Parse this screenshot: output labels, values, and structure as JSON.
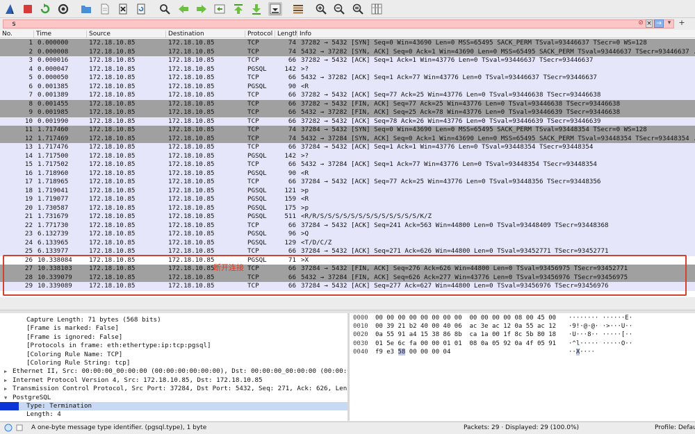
{
  "toolbar": {
    "icons": [
      "shark-fin-icon",
      "stop-capture-icon",
      "restart-capture-icon",
      "capture-options-icon",
      "open-file-icon",
      "save-file-icon",
      "close-file-icon",
      "reload-file-icon",
      "find-packet-icon",
      "go-back-icon",
      "go-forward-icon",
      "go-to-packet-icon",
      "go-first-icon",
      "go-last-icon",
      "autoscroll-icon",
      "colorize-icon",
      "zoom-in-icon",
      "zoom-out-icon",
      "zoom-normal-icon",
      "resize-columns-icon"
    ]
  },
  "filter": {
    "value": "s",
    "plus": "+"
  },
  "columns": [
    "No.",
    "Time",
    "Source",
    "Destination",
    "Protocol",
    "Length",
    "Info"
  ],
  "packets": [
    {
      "no": "1",
      "time": "0.000000",
      "src": "172.18.10.85",
      "dst": "172.18.10.85",
      "proto": "TCP",
      "len": "74",
      "info": "37282 → 5432 [SYN] Seq=0 Win=43690 Len=0 MSS=65495 SACK_PERM TSval=93446637 TSecr=0 WS=128",
      "style": "dark"
    },
    {
      "no": "2",
      "time": "0.000008",
      "src": "172.18.10.85",
      "dst": "172.18.10.85",
      "proto": "TCP",
      "len": "74",
      "info": "5432 → 37282 [SYN, ACK] Seq=0 Ack=1 Win=43690 Len=0 MSS=65495 SACK_PERM TSval=93446637 TSecr=93446637 ...",
      "style": "dark"
    },
    {
      "no": "3",
      "time": "0.000016",
      "src": "172.18.10.85",
      "dst": "172.18.10.85",
      "proto": "TCP",
      "len": "66",
      "info": "37282 → 5432 [ACK] Seq=1 Ack=1 Win=43776 Len=0 TSval=93446637 TSecr=93446637",
      "style": "light"
    },
    {
      "no": "4",
      "time": "0.000047",
      "src": "172.18.10.85",
      "dst": "172.18.10.85",
      "proto": "PGSQL",
      "len": "142",
      "info": ">?",
      "style": "light"
    },
    {
      "no": "5",
      "time": "0.000050",
      "src": "172.18.10.85",
      "dst": "172.18.10.85",
      "proto": "TCP",
      "len": "66",
      "info": "5432 → 37282 [ACK] Seq=1 Ack=77 Win=43776 Len=0 TSval=93446637 TSecr=93446637",
      "style": "light"
    },
    {
      "no": "6",
      "time": "0.001385",
      "src": "172.18.10.85",
      "dst": "172.18.10.85",
      "proto": "PGSQL",
      "len": "90",
      "info": "<R",
      "style": "light"
    },
    {
      "no": "7",
      "time": "0.001389",
      "src": "172.18.10.85",
      "dst": "172.18.10.85",
      "proto": "TCP",
      "len": "66",
      "info": "37282 → 5432 [ACK] Seq=77 Ack=25 Win=43776 Len=0 TSval=93446638 TSecr=93446638",
      "style": "light"
    },
    {
      "no": "8",
      "time": "0.001455",
      "src": "172.18.10.85",
      "dst": "172.18.10.85",
      "proto": "TCP",
      "len": "66",
      "info": "37282 → 5432 [FIN, ACK] Seq=77 Ack=25 Win=43776 Len=0 TSval=93446638 TSecr=93446638",
      "style": "dark"
    },
    {
      "no": "9",
      "time": "0.001985",
      "src": "172.18.10.85",
      "dst": "172.18.10.85",
      "proto": "TCP",
      "len": "66",
      "info": "5432 → 37282 [FIN, ACK] Seq=25 Ack=78 Win=43776 Len=0 TSval=93446639 TSecr=93446638",
      "style": "dark"
    },
    {
      "no": "10",
      "time": "0.001990",
      "src": "172.18.10.85",
      "dst": "172.18.10.85",
      "proto": "TCP",
      "len": "66",
      "info": "37282 → 5432 [ACK] Seq=78 Ack=26 Win=43776 Len=0 TSval=93446639 TSecr=93446639",
      "style": "light"
    },
    {
      "no": "11",
      "time": "1.717460",
      "src": "172.18.10.85",
      "dst": "172.18.10.85",
      "proto": "TCP",
      "len": "74",
      "info": "37284 → 5432 [SYN] Seq=0 Win=43690 Len=0 MSS=65495 SACK_PERM TSval=93448354 TSecr=0 WS=128",
      "style": "dark"
    },
    {
      "no": "12",
      "time": "1.717469",
      "src": "172.18.10.85",
      "dst": "172.18.10.85",
      "proto": "TCP",
      "len": "74",
      "info": "5432 → 37284 [SYN, ACK] Seq=0 Ack=1 Win=43690 Len=0 MSS=65495 SACK_PERM TSval=93448354 TSecr=93448354 ...",
      "style": "dark"
    },
    {
      "no": "13",
      "time": "1.717476",
      "src": "172.18.10.85",
      "dst": "172.18.10.85",
      "proto": "TCP",
      "len": "66",
      "info": "37284 → 5432 [ACK] Seq=1 Ack=1 Win=43776 Len=0 TSval=93448354 TSecr=93448354",
      "style": "light"
    },
    {
      "no": "14",
      "time": "1.717500",
      "src": "172.18.10.85",
      "dst": "172.18.10.85",
      "proto": "PGSQL",
      "len": "142",
      "info": ">?",
      "style": "light"
    },
    {
      "no": "15",
      "time": "1.717502",
      "src": "172.18.10.85",
      "dst": "172.18.10.85",
      "proto": "TCP",
      "len": "66",
      "info": "5432 → 37284 [ACK] Seq=1 Ack=77 Win=43776 Len=0 TSval=93448354 TSecr=93448354",
      "style": "light"
    },
    {
      "no": "16",
      "time": "1.718960",
      "src": "172.18.10.85",
      "dst": "172.18.10.85",
      "proto": "PGSQL",
      "len": "90",
      "info": "<R",
      "style": "light"
    },
    {
      "no": "17",
      "time": "1.718965",
      "src": "172.18.10.85",
      "dst": "172.18.10.85",
      "proto": "TCP",
      "len": "66",
      "info": "37284 → 5432 [ACK] Seq=77 Ack=25 Win=43776 Len=0 TSval=93448356 TSecr=93448356",
      "style": "light"
    },
    {
      "no": "18",
      "time": "1.719041",
      "src": "172.18.10.85",
      "dst": "172.18.10.85",
      "proto": "PGSQL",
      "len": "121",
      "info": ">p",
      "style": "light"
    },
    {
      "no": "19",
      "time": "1.719077",
      "src": "172.18.10.85",
      "dst": "172.18.10.85",
      "proto": "PGSQL",
      "len": "159",
      "info": "<R",
      "style": "light"
    },
    {
      "no": "20",
      "time": "1.730587",
      "src": "172.18.10.85",
      "dst": "172.18.10.85",
      "proto": "PGSQL",
      "len": "175",
      "info": ">p",
      "style": "light"
    },
    {
      "no": "21",
      "time": "1.731679",
      "src": "172.18.10.85",
      "dst": "172.18.10.85",
      "proto": "PGSQL",
      "len": "511",
      "info": "<R/R/S/S/S/S/S/S/S/S/S/S/S/S/S/K/Z",
      "style": "light"
    },
    {
      "no": "22",
      "time": "1.771730",
      "src": "172.18.10.85",
      "dst": "172.18.10.85",
      "proto": "TCP",
      "len": "66",
      "info": "37284 → 5432 [ACK] Seq=241 Ack=563 Win=44800 Len=0 TSval=93448409 TSecr=93448368",
      "style": "light"
    },
    {
      "no": "23",
      "time": "6.132739",
      "src": "172.18.10.85",
      "dst": "172.18.10.85",
      "proto": "PGSQL",
      "len": "96",
      "info": ">Q",
      "style": "light"
    },
    {
      "no": "24",
      "time": "6.133965",
      "src": "172.18.10.85",
      "dst": "172.18.10.85",
      "proto": "PGSQL",
      "len": "129",
      "info": "<T/D/C/Z",
      "style": "light"
    },
    {
      "no": "25",
      "time": "6.133977",
      "src": "172.18.10.85",
      "dst": "172.18.10.85",
      "proto": "TCP",
      "len": "66",
      "info": "37284 → 5432 [ACK] Seq=271 Ack=626 Win=44800 Len=0 TSval=93452771 TSecr=93452771",
      "style": "light"
    },
    {
      "no": "26",
      "time": "10.338084",
      "src": "172.18.10.85",
      "dst": "172.18.10.85",
      "proto": "PGSQL",
      "len": "71",
      "info": ">X",
      "style": "sel"
    },
    {
      "no": "27",
      "time": "10.338103",
      "src": "172.18.10.85",
      "dst": "172.18.10.85",
      "proto": "TCP",
      "len": "66",
      "info": "37284 → 5432 [FIN, ACK] Seq=276 Ack=626 Win=44800 Len=0 TSval=93456975 TSecr=93452771",
      "style": "dark"
    },
    {
      "no": "28",
      "time": "10.339079",
      "src": "172.18.10.85",
      "dst": "172.18.10.85",
      "proto": "TCP",
      "len": "66",
      "info": "5432 → 37284 [FIN, ACK] Seq=626 Ack=277 Win=43776 Len=0 TSval=93456976 TSecr=93456975",
      "style": "dark"
    },
    {
      "no": "29",
      "time": "10.339089",
      "src": "172.18.10.85",
      "dst": "172.18.10.85",
      "proto": "TCP",
      "len": "66",
      "info": "37284 → 5432 [ACK] Seq=277 Ack=627 Win=44800 Len=0 TSval=93456976 TSecr=93456976",
      "style": "light"
    }
  ],
  "annotation": {
    "text": "断开连接",
    "color": "#d4402a"
  },
  "details": [
    {
      "text": "Capture Length: 71 bytes (568 bits)",
      "indent": 2,
      "arrow": ""
    },
    {
      "text": "[Frame is marked: False]",
      "indent": 2,
      "arrow": ""
    },
    {
      "text": "[Frame is ignored: False]",
      "indent": 2,
      "arrow": ""
    },
    {
      "text": "[Protocols in frame: eth:ethertype:ip:tcp:pgsql]",
      "indent": 2,
      "arrow": ""
    },
    {
      "text": "[Coloring Rule Name: TCP]",
      "indent": 2,
      "arrow": ""
    },
    {
      "text": "[Coloring Rule String: tcp]",
      "indent": 2,
      "arrow": ""
    },
    {
      "text": "Ethernet II, Src: 00:00:00_00:00:00 (00:00:00:00:00:00), Dst: 00:00:00_00:00:00 (00:00:00:00:00:00)",
      "indent": 0,
      "arrow": ">"
    },
    {
      "text": "Internet Protocol Version 4, Src: 172.18.10.85, Dst: 172.18.10.85",
      "indent": 0,
      "arrow": ">"
    },
    {
      "text": "Transmission Control Protocol, Src Port: 37284, Dst Port: 5432, Seq: 271, Ack: 626, Len: 5",
      "indent": 0,
      "arrow": ">"
    },
    {
      "text": "PostgreSQL",
      "indent": 0,
      "arrow": "v"
    },
    {
      "text": "Type: Termination",
      "indent": 1,
      "arrow": "",
      "selected": true
    },
    {
      "text": "Length: 4",
      "indent": 1,
      "arrow": ""
    }
  ],
  "bytes": [
    {
      "off": "0000",
      "hex": "00 00 00 00 00 00 00 00  00 00 00 00 08 00 45 00",
      "ascii": "········ ······E·"
    },
    {
      "off": "0010",
      "hex": "00 39 21 b2 40 00 40 06  ac 3e ac 12 0a 55 ac 12",
      "ascii": "·9!·@·@· ·>···U··"
    },
    {
      "off": "0020",
      "hex": "0a 55 91 a4 15 38 86 8b  ca 1a 00 1f 8c 5b 80 18",
      "ascii": "·U···8·· ·····[··"
    },
    {
      "off": "0030",
      "hex": "01 5e 6c fa 00 00 01 01  08 0a 05 92 0a 4f 05 91",
      "ascii": "·^l····· ·····O··"
    },
    {
      "off": "0040",
      "hex_pre": "f9 e3 ",
      "hex_hl": "58",
      "hex_post": " 00 00 00 04",
      "ascii_pre": "··",
      "ascii_hl": "X",
      "ascii_post": "····"
    }
  ],
  "status": {
    "message": "A one-byte message type identifier. (pgsql.type), 1 byte",
    "packets": "Packets: 29 · Displayed: 29 (100.0%)",
    "profile": "Profile: Default"
  }
}
